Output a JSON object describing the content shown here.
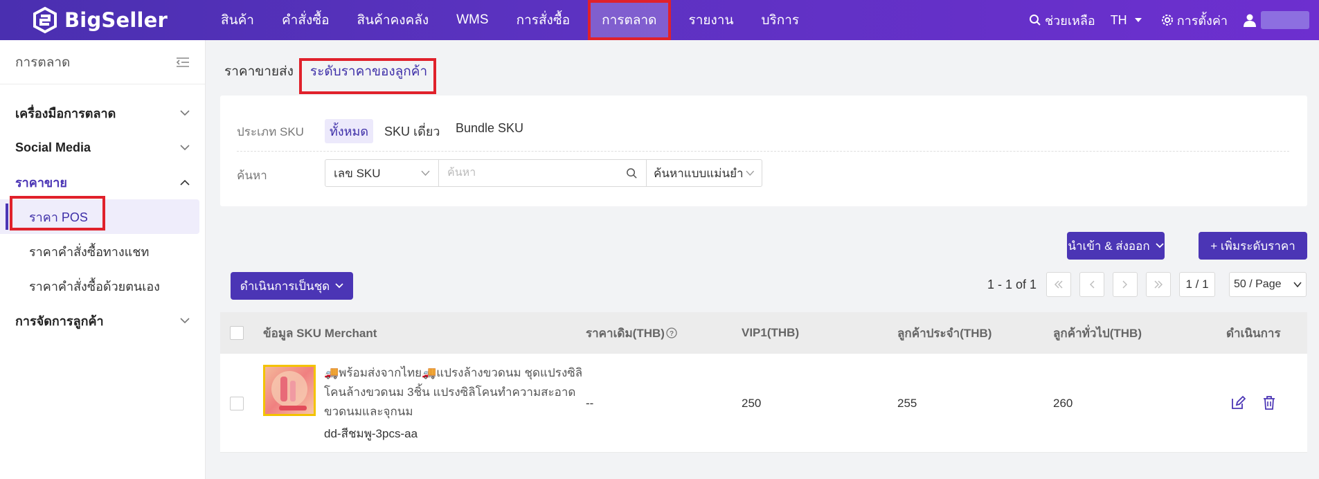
{
  "brand": {
    "name": "BigSeller"
  },
  "nav": {
    "items": [
      {
        "label": "สินค้า"
      },
      {
        "label": "คำสั่งซื้อ"
      },
      {
        "label": "สินค้าคงคลัง"
      },
      {
        "label": "WMS"
      },
      {
        "label": "การสั่งซื้อ"
      },
      {
        "label": "การตลาด",
        "active": true
      },
      {
        "label": "รายงาน"
      },
      {
        "label": "บริการ"
      }
    ],
    "help": "ช่วยเหลือ",
    "language": "TH",
    "settings": "การตั้งค่า"
  },
  "sidebar": {
    "title": "การตลาด",
    "groups": [
      {
        "label": "เครื่องมือการตลาด"
      },
      {
        "label": "Social Media"
      },
      {
        "label": "ราคาขาย"
      },
      {
        "label": "การจัดการลูกค้า"
      }
    ],
    "subitems": [
      {
        "label": "ราคา POS"
      },
      {
        "label": "ราคาคำสั่งซื้อทางแชท"
      },
      {
        "label": "ราคาคำสั่งซื้อด้วยตนเอง"
      }
    ]
  },
  "tabs": [
    {
      "label": "ราคาขายส่ง"
    },
    {
      "label": "ระดับราคาของลูกค้า",
      "active": true
    }
  ],
  "filter": {
    "sku_type_label": "ประเภท SKU",
    "sku_types": [
      "ทั้งหมด",
      "SKU เดี่ยว",
      "Bundle SKU"
    ],
    "search_label": "ค้นหา",
    "search_field": "เลข SKU",
    "search_placeholder": "ค้นหา",
    "match_mode": "ค้นหาแบบแม่นยำ"
  },
  "actions": {
    "import_export": "นำเข้า & ส่งออก",
    "add_price_level": "+ เพิ่มระดับราคา",
    "bulk_action": "ดำเนินการเป็นชุด"
  },
  "pagination": {
    "summary": "1 - 1 of 1",
    "page": "1 / 1",
    "page_size": "50 / Page"
  },
  "table": {
    "headers": [
      "ข้อมูล SKU Merchant",
      "ราคาเดิม(THB)",
      "VIP1(THB)",
      "ลูกค้าประจำ(THB)",
      "ลูกค้าทั่วไป(THB)",
      "ดำเนินการ"
    ],
    "rows": [
      {
        "name": "🚚พร้อมส่งจากไทย🚚แปรงล้างขวดนม ชุดแปรงซิลิโคนล้างขวดนม 3ชิ้น แปรงซิลิโคนทำความสะอาดขวดนมและจุกนม",
        "sku": "dd-สีชมพู-3pcs-aa",
        "original_price": "--",
        "vip1": "250",
        "regular": "255",
        "general": "260"
      }
    ]
  },
  "colors": {
    "brand": "#4b35b5",
    "highlight": "#e0212b"
  }
}
